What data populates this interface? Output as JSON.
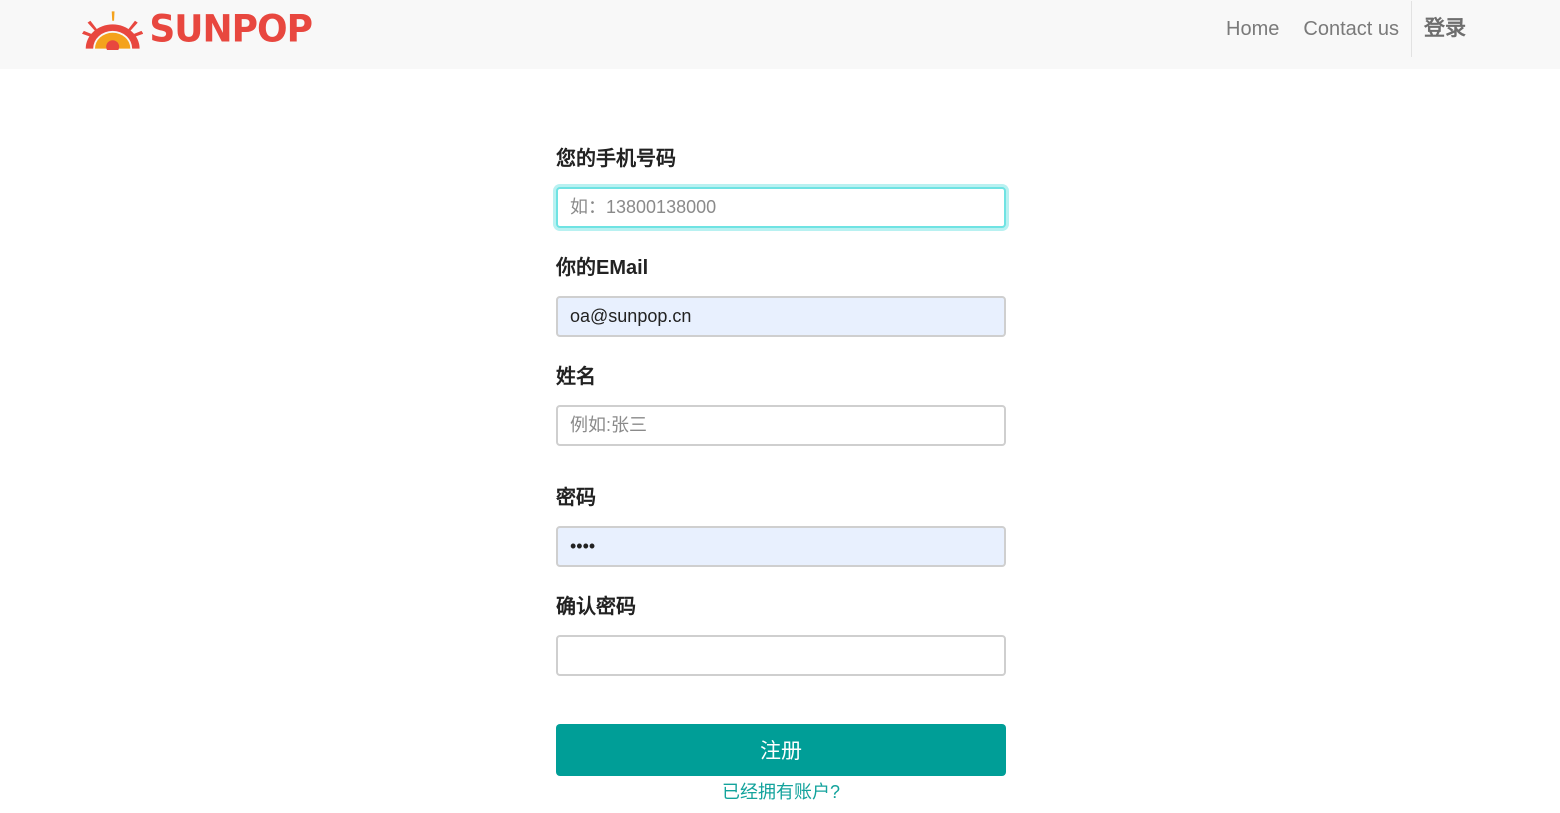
{
  "header": {
    "logo_text": "SUNPOP",
    "nav": {
      "home": "Home",
      "contact": "Contact us",
      "login": "登录"
    },
    "brand_color": "#e8473f"
  },
  "form": {
    "phone": {
      "label": "您的手机号码",
      "placeholder": "如：13800138000",
      "value": ""
    },
    "email": {
      "label": "你的EMail",
      "placeholder": "",
      "value": "oa@sunpop.cn"
    },
    "name": {
      "label": "姓名",
      "placeholder": "例如:张三",
      "value": ""
    },
    "password": {
      "label": "密码",
      "value": "••••"
    },
    "confirm_password": {
      "label": "确认密码",
      "value": ""
    },
    "submit_label": "注册",
    "login_link": "已经拥有账户?",
    "accent_color": "#009e97"
  }
}
